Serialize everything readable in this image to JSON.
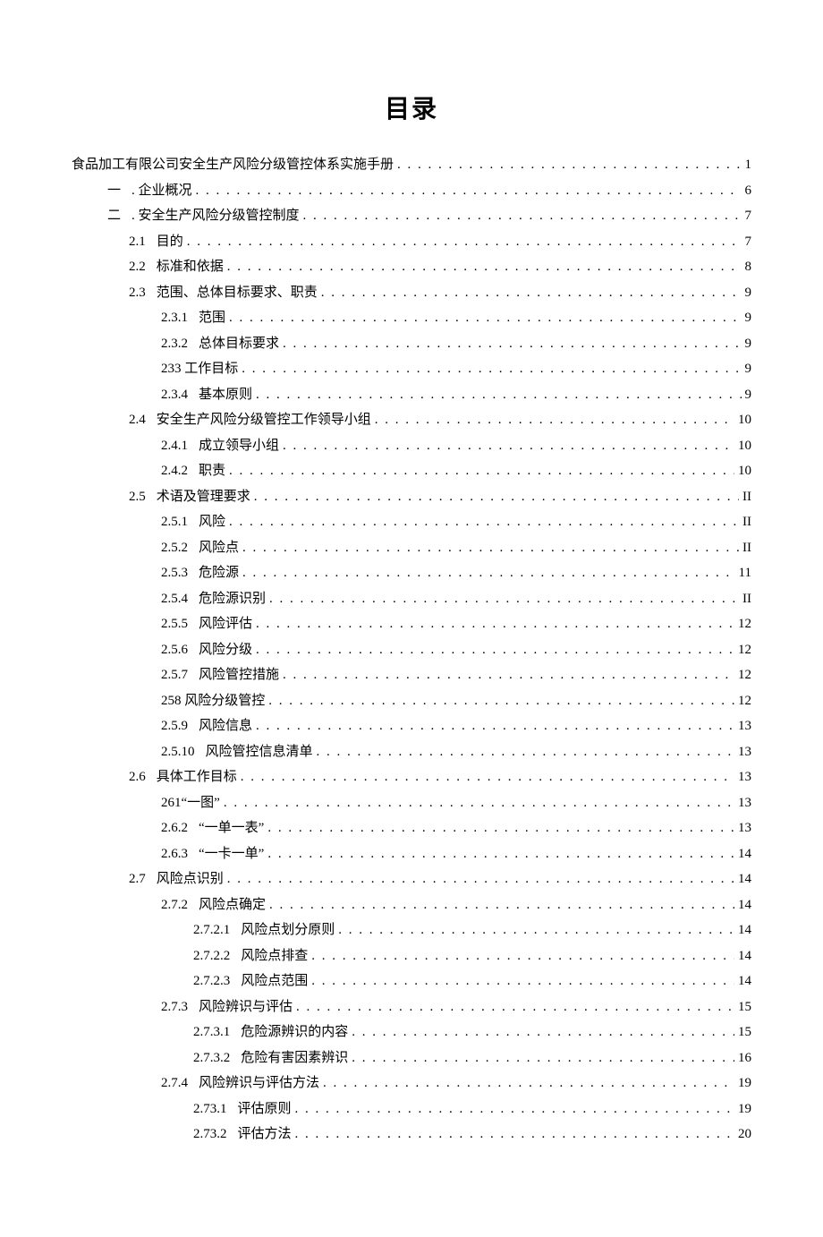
{
  "title": "目录",
  "toc": [
    {
      "level": 0,
      "num": "",
      "text": "食品加工有限公司安全生产风险分级管控体系实施手册",
      "page": "1"
    },
    {
      "level": 1,
      "num": "一",
      "text": ". 企业概况",
      "page": "6"
    },
    {
      "level": 1,
      "num": "二",
      "text": ". 安全生产风险分级管控制度",
      "page": "7"
    },
    {
      "level": 2,
      "num": "2.1",
      "text": "目的",
      "page": "7"
    },
    {
      "level": 2,
      "num": "2.2",
      "text": "标准和依据",
      "page": "8"
    },
    {
      "level": 2,
      "num": "2.3",
      "text": "范围、总体目标要求、职责",
      "page": "9"
    },
    {
      "level": 3,
      "num": "2.3.1",
      "text": "范围",
      "page": "9"
    },
    {
      "level": 3,
      "num": "2.3.2",
      "text": "总体目标要求",
      "page": "9"
    },
    {
      "level": 3,
      "num": "",
      "text": "233 工作目标",
      "page": "9"
    },
    {
      "level": 3,
      "num": "2.3.4",
      "text": "基本原则",
      "page": "9"
    },
    {
      "level": 2,
      "num": "2.4",
      "text": "安全生产风险分级管控工作领导小组",
      "page": "10"
    },
    {
      "level": 3,
      "num": "2.4.1",
      "text": "成立领导小组",
      "page": "10"
    },
    {
      "level": 3,
      "num": "2.4.2",
      "text": "职责",
      "page": "10"
    },
    {
      "level": 2,
      "num": "2.5",
      "text": "术语及管理要求",
      "page": "II"
    },
    {
      "level": 3,
      "num": "2.5.1",
      "text": "风险",
      "page": "II"
    },
    {
      "level": 3,
      "num": "2.5.2",
      "text": "风险点",
      "page": "II"
    },
    {
      "level": 3,
      "num": "2.5.3",
      "text": "危险源",
      "page": "11"
    },
    {
      "level": 3,
      "num": "2.5.4",
      "text": "危险源识别",
      "page": "II"
    },
    {
      "level": 3,
      "num": "2.5.5",
      "text": "风险评估",
      "page": "12"
    },
    {
      "level": 3,
      "num": "2.5.6",
      "text": "风险分级",
      "page": "12"
    },
    {
      "level": 3,
      "num": "2.5.7",
      "text": "风险管控措施",
      "page": "12"
    },
    {
      "level": 3,
      "num": "",
      "text": "258 风险分级管控",
      "page": "12"
    },
    {
      "level": 3,
      "num": "2.5.9",
      "text": "风险信息",
      "page": "13"
    },
    {
      "level": 3,
      "num": "2.5.10",
      "text": "风险管控信息清单",
      "page": "13"
    },
    {
      "level": 2,
      "num": "2.6",
      "text": "具体工作目标",
      "page": "13"
    },
    {
      "level": 3,
      "num": "",
      "text": "261“一图”",
      "page": "13"
    },
    {
      "level": 3,
      "num": "2.6.2",
      "text": "“一单一表”",
      "page": "13"
    },
    {
      "level": 3,
      "num": "2.6.3",
      "text": "“一卡一单”",
      "page": "14"
    },
    {
      "level": 2,
      "num": "2.7",
      "text": "风险点识别",
      "page": "14"
    },
    {
      "level": 3,
      "num": "2.7.2",
      "text": "风险点确定",
      "page": "14"
    },
    {
      "level": 4,
      "num": "2.7.2.1",
      "text": "风险点划分原则",
      "page": "14"
    },
    {
      "level": 4,
      "num": "2.7.2.2",
      "text": "风险点排查",
      "page": "14"
    },
    {
      "level": 4,
      "num": "2.7.2.3",
      "text": "风险点范围",
      "page": "14"
    },
    {
      "level": 3,
      "num": "2.7.3",
      "text": "风险辨识与评估",
      "page": "15"
    },
    {
      "level": 4,
      "num": "2.7.3.1",
      "text": "危险源辨识的内容",
      "page": "15"
    },
    {
      "level": 4,
      "num": "2.7.3.2",
      "text": "危险有害因素辨识",
      "page": "16"
    },
    {
      "level": 3,
      "num": "2.7.4",
      "text": "风险辨识与评估方法",
      "page": "19"
    },
    {
      "level": 4,
      "num": "2.73.1",
      "text": "评估原则",
      "page": "19"
    },
    {
      "level": 4,
      "num": "2.73.2",
      "text": "评估方法",
      "page": "20"
    }
  ]
}
